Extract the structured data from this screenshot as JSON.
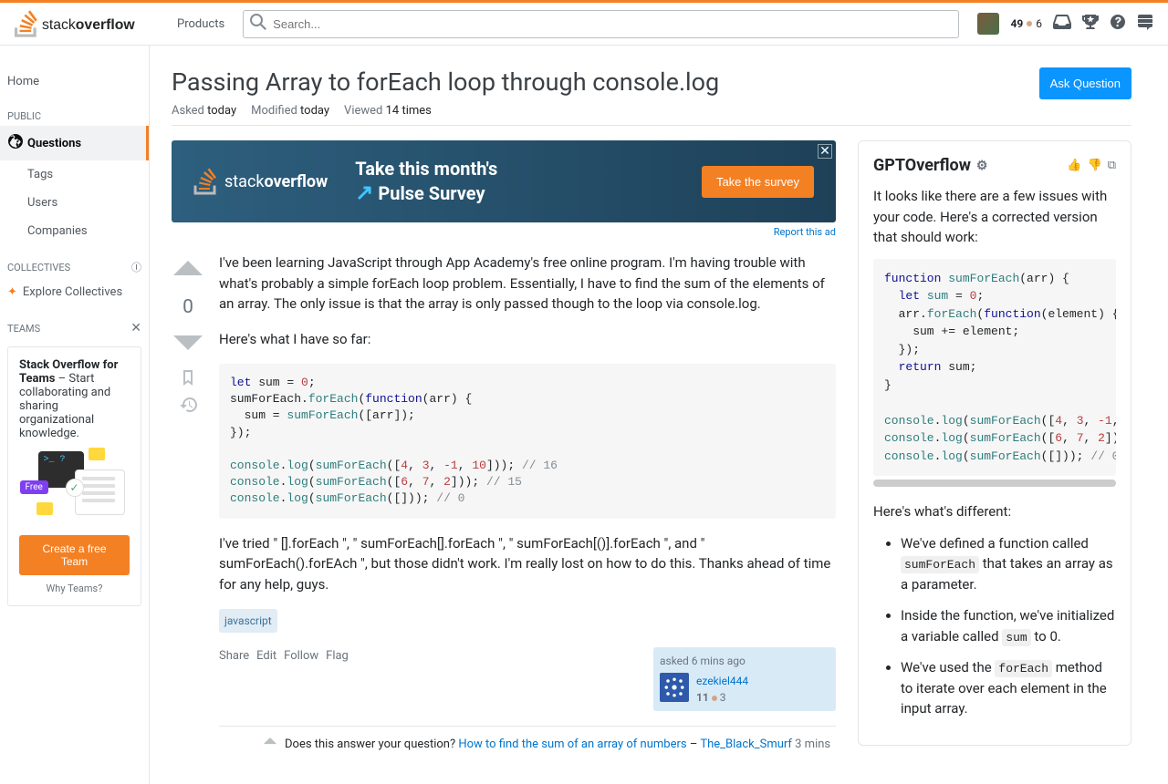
{
  "topbar": {
    "products": "Products",
    "search_placeholder": "Search...",
    "reputation": "49",
    "bronze": "6"
  },
  "sidebar": {
    "home": "Home",
    "public": "PUBLIC",
    "questions": "Questions",
    "tags": "Tags",
    "users": "Users",
    "companies": "Companies",
    "collectives": "COLLECTIVES",
    "explore": "Explore Collectives",
    "teams": "TEAMS",
    "teams_title": "Stack Overflow for Teams",
    "teams_desc": " – Start collaborating and sharing organizational knowledge.",
    "free": "Free",
    "create_team": "Create a free Team",
    "why_teams": "Why Teams?"
  },
  "question": {
    "title": "Passing Array to forEach loop through console.log",
    "asked_label": "Asked",
    "asked_value": "today",
    "modified_label": "Modified",
    "modified_value": "today",
    "viewed_label": "Viewed",
    "viewed_value": "14 times",
    "ask_button": "Ask Question"
  },
  "ad": {
    "brand": "stackoverflow",
    "line1": "Take this month's",
    "line2": "Pulse Survey",
    "button": "Take the survey",
    "report": "Report this ad"
  },
  "post": {
    "vote_count": "0",
    "para1": "I've been learning JavaScript through App Academy's free online program. I'm having trouble with what's probably a simple forEach loop problem. Essentially, I have to find the sum of the elements of an array. The only issue is that the array is only passed though to the loop via console.log.",
    "para2": "Here's what I have so far:",
    "para3": "I've tried \" [].forEach \", \" sumForEach[].forEach \", \" sumForEach[()].forEach \", and \" sumForEach().forEAch \", but those didn't work. I'm really lost on how to do this. Thanks ahead of time for any help, guys.",
    "tag": "javascript",
    "actions": {
      "share": "Share",
      "edit": "Edit",
      "follow": "Follow",
      "flag": "Flag"
    },
    "user_card": {
      "asked": "asked 6 mins ago",
      "name": "ezekiel444",
      "rep": "11",
      "bronze": "3"
    }
  },
  "comment": {
    "prefix": "Does this answer your question? ",
    "link": "How to find the sum of an array of numbers",
    "sep": " – ",
    "user": "The_Black_Smurf",
    "time": "3 mins"
  },
  "gpt": {
    "title": "GPTOverflow",
    "intro": "It looks like there are a few issues with your code. Here's a corrected version that should work:",
    "diff_intro": "Here's what's different:",
    "b1a": "We've defined a function called ",
    "b1code": "sumForEach",
    "b1b": " that takes an array as a parameter.",
    "b2a": "Inside the function, we've initialized a variable called ",
    "b2code": "sum",
    "b2b": " to 0.",
    "b3a": "We've used the ",
    "b3code": "forEach",
    "b3b": " method to iterate over each element in the input array."
  }
}
